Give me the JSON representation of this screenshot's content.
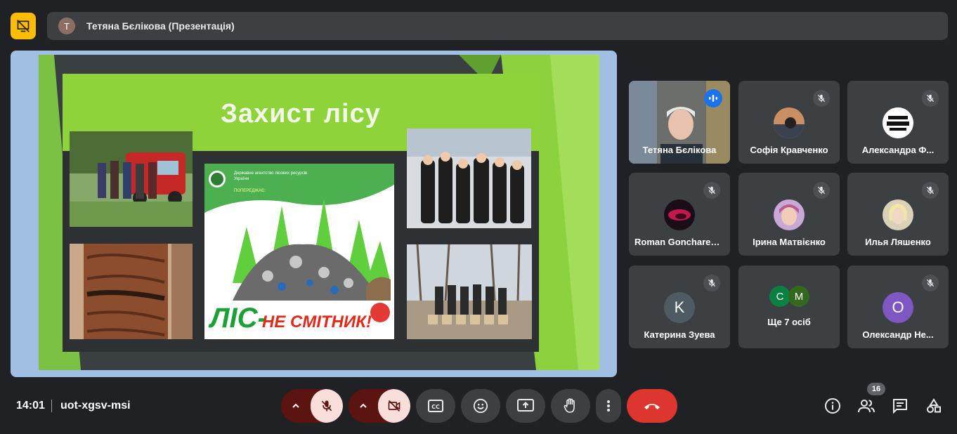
{
  "header": {
    "presenter_avatar_letter": "T",
    "presenter_title": "Тетяна Бєлікова (Презентація)",
    "present_icon": "presentation-off-icon"
  },
  "slide": {
    "title": "Захист лісу",
    "poster_org": "Державне агентство лісових ресурсів України",
    "poster_warning": "ПОПЕРЕДЖАЄ:",
    "poster_slogan_main": "ЛІС-",
    "poster_slogan_rest": "НЕ СМІТНИК!"
  },
  "participants": [
    {
      "name": "Тетяна Бєлікова",
      "avatar": "photo",
      "mic": "speaking"
    },
    {
      "name": "Софія Кравченко",
      "avatar": "photo",
      "mic": "muted"
    },
    {
      "name": "Александра Ф...",
      "avatar": "photo",
      "mic": "muted"
    },
    {
      "name": "Roman Goncharenko",
      "avatar": "photo",
      "mic": "muted"
    },
    {
      "name": "Ірина Матвієнко",
      "avatar": "photo",
      "mic": "muted"
    },
    {
      "name": "Илья Ляшенко",
      "avatar": "photo",
      "mic": "muted"
    },
    {
      "name": "Катерина Зуева",
      "avatar_letter": "K",
      "avatar_color": "#4f5b62",
      "mic": "muted"
    },
    {
      "name": "Ще 7 осіб",
      "avatar_letters": [
        "С",
        "М"
      ],
      "avatar_colors": [
        "#0b8043",
        "#33691e"
      ]
    },
    {
      "name": "Олександр Не...",
      "avatar_letter": "O",
      "avatar_color": "#7e57c2",
      "mic": "muted"
    }
  ],
  "footer": {
    "time": "14:01",
    "meeting_code": "uot-xgsv-msi",
    "people_count": "16"
  },
  "colors": {
    "accent_yellow": "#fbbc04",
    "end_call_red": "#dc362e",
    "speaking_blue": "#1a73e8",
    "tile_bg": "#3c4043",
    "page_bg": "#202124"
  }
}
